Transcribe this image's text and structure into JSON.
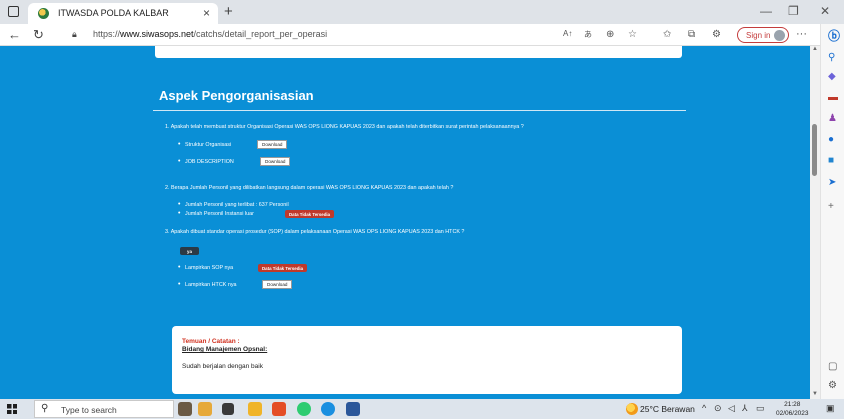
{
  "browser": {
    "tab_title": "ITWASDA POLDA KALBAR",
    "tab_close": "×",
    "new_tab": "+",
    "url_prefix": "https://",
    "url_host": "www.siwasops.net",
    "url_path": "/catchs/detail_report_per_operasi",
    "sign_in": "Sign in",
    "more": "···"
  },
  "section": {
    "title": "Aspek Pengorganisasian"
  },
  "questions": [
    {
      "text": "1. Apakah telah membuat struktur Organisasi Operasi WAS OPS LIONG KAPUAS 2023 dan apakah telah diterbitkan surat perintah pelaksanaannya ?",
      "items": [
        {
          "label": "Struktur Organisasi",
          "button": "Download"
        },
        {
          "label": "JOB DESCRIPTION",
          "button": "Download"
        }
      ]
    },
    {
      "text": "2. Berapa Jumlah Personil yang dilibatkan langsung dalam operasi WAS OPS LIONG KAPUAS 2023 dan apakah telah ?",
      "items": [
        {
          "label": "Jumlah Personil yang terlibat : 637 Personil"
        },
        {
          "label": "Jumlah Personil Instansi luar",
          "badge": "Data Tidak Tersedia"
        }
      ]
    },
    {
      "text": "3. Apakah dibuat standar operasi prosedur (SOP) dalam pelaksanaan Operasi WAS OPS LIONG KAPUAS 2023 dan HTCK ?",
      "answer": "ya",
      "items": [
        {
          "label": "Lampirkan SOP nya",
          "badge": "Data Tidak Tersedia"
        },
        {
          "label": "Lampirkan HTCK nya",
          "button": "Download"
        }
      ]
    }
  ],
  "notes": {
    "heading": "Temuan / Catatan :",
    "subheading": "Bidang Manajemen Opsnal:",
    "text": "Sudah berjalan dengan baik"
  },
  "taskbar": {
    "search_placeholder": "Type to search",
    "weather": "25°C Berawan",
    "time": "21:28",
    "date": "02/06/2023"
  },
  "colors": {
    "page_bg": "#0a8fd6",
    "badge_red": "#c0392b",
    "badge_dark": "#2b3a46",
    "notes_heading": "#d0311f"
  }
}
